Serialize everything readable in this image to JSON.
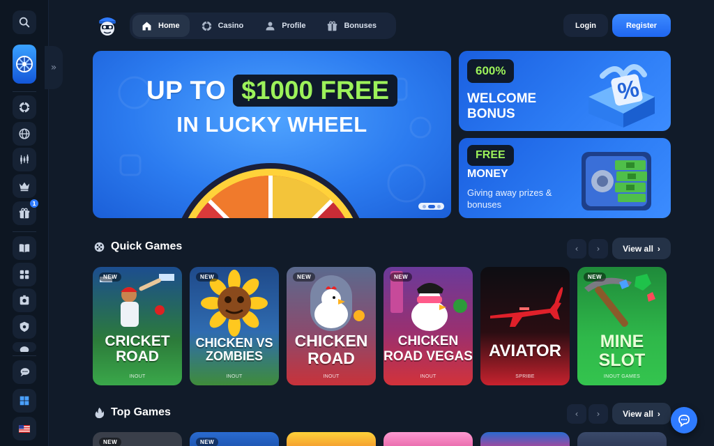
{
  "nav": {
    "items": [
      {
        "label": "Home",
        "icon": "home-icon"
      },
      {
        "label": "Casino",
        "icon": "poker-chip-icon"
      },
      {
        "label": "Profile",
        "icon": "user-icon"
      },
      {
        "label": "Bonuses",
        "icon": "gift-icon"
      }
    ],
    "login": "Login",
    "register": "Register"
  },
  "sidebar": {
    "badge": "1",
    "icons": [
      "search-icon",
      "lucky-wheel-icon",
      "expand-icon",
      "poker-chip-icon",
      "globe-icon",
      "trading-icon",
      "crown-icon",
      "gift-icon",
      "book-icon",
      "puzzle-icon",
      "safe-icon",
      "shield-icon",
      "chat-bubbles-icon",
      "windows-icon",
      "us-flag-icon"
    ]
  },
  "hero": {
    "line1_prefix": "UP TO",
    "amount": "$1000 FREE",
    "line2": "IN LUCKY WHEEL",
    "prev": "‹",
    "next": "›"
  },
  "promos": [
    {
      "tag": "600%",
      "title": "WELCOME BONUS"
    },
    {
      "tag": "FREE",
      "title": "MONEY",
      "subtitle": "Giving away prizes & bonuses"
    }
  ],
  "quick_games": {
    "title": "Quick Games",
    "view_all": "View all",
    "games": [
      {
        "badge": "NEW",
        "title": "CRICKET ROAD",
        "provider": "INOUT"
      },
      {
        "badge": "NEW",
        "title": "CHICKEN VS ZOMBIES",
        "provider": "INOUT"
      },
      {
        "badge": "NEW",
        "title": "CHICKEN ROAD",
        "provider": "INOUT"
      },
      {
        "badge": "NEW",
        "title": "CHICKEN ROAD VEGAS",
        "provider": "INOUT"
      },
      {
        "badge": "",
        "title": "AVIATOR",
        "provider": "SPRIBE"
      },
      {
        "badge": "NEW",
        "title": "MINE SLOT",
        "provider": "INOUT GAMES"
      }
    ]
  },
  "top_games": {
    "title": "Top Games",
    "view_all": "View all",
    "badges": [
      "NEW",
      "NEW",
      "",
      "",
      "",
      ""
    ]
  },
  "colors": {
    "background": "#111b29",
    "accent_blue": "#2f7bff",
    "accent_green": "#9cf25a"
  }
}
